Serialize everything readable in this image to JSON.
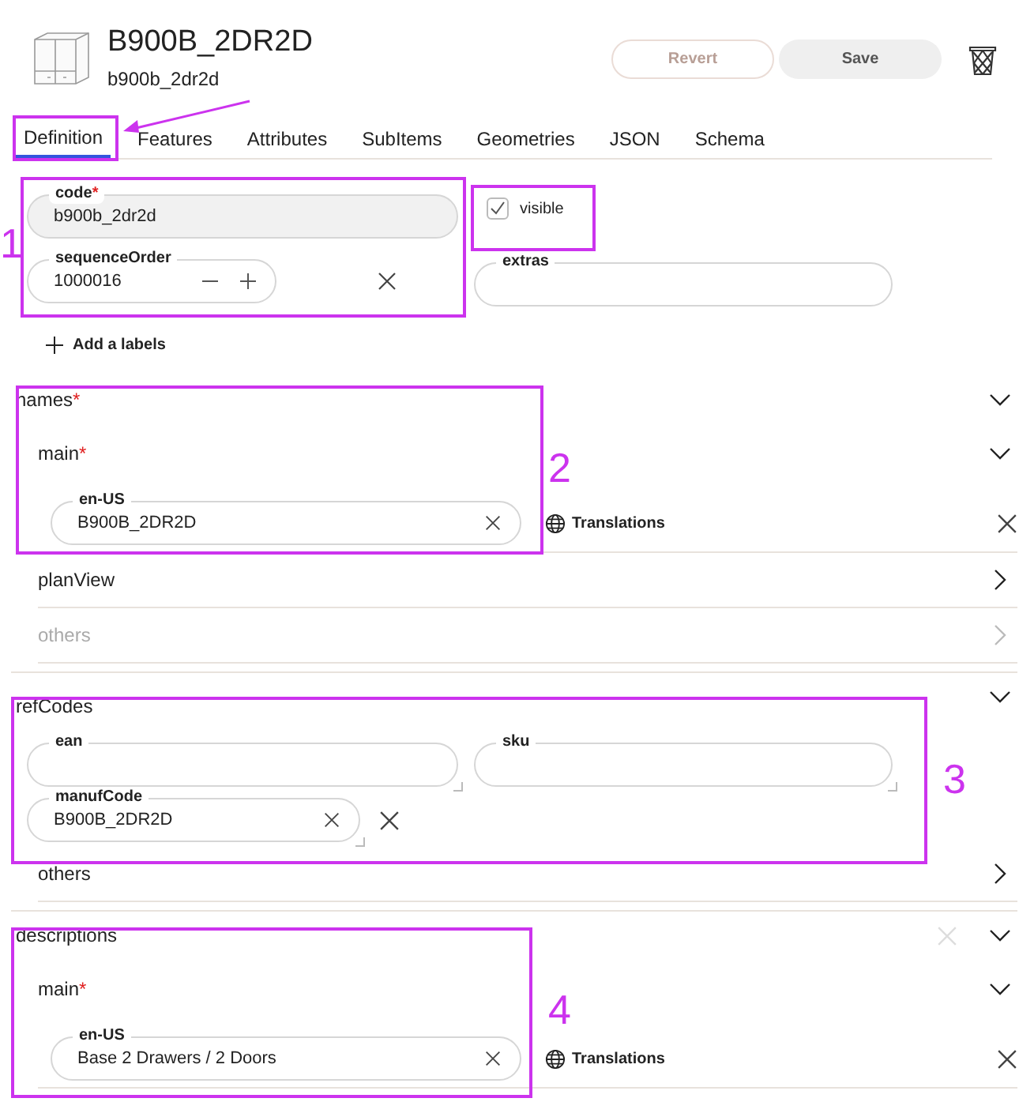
{
  "header": {
    "title": "B900B_2DR2D",
    "subtitle": "b900b_2dr2d",
    "buttons": [
      {
        "label": "Revert",
        "disabled": true
      },
      {
        "label": "Save",
        "disabled": false
      }
    ]
  },
  "tabs": [
    {
      "label": "Definition",
      "selected": true
    },
    {
      "label": "Features",
      "selected": false
    },
    {
      "label": "Attributes",
      "selected": false
    },
    {
      "label": "SubItems",
      "selected": false
    },
    {
      "label": "Geometries",
      "selected": false
    },
    {
      "label": "JSON",
      "selected": false
    },
    {
      "label": "Schema",
      "selected": false
    }
  ],
  "definition": {
    "code": {
      "label": "code",
      "marker": "*",
      "value": "b900b_2dr2d"
    },
    "sequence_order": {
      "label": "sequenceOrder",
      "value": "1000016"
    },
    "visible": {
      "label": "visible",
      "checked": true
    },
    "extras": {
      "label": "extras"
    },
    "add_label": "Add a labels"
  },
  "sections": [
    {
      "title": "names",
      "marker": "*",
      "expanded": true,
      "children": [
        {
          "kind": "locale",
          "title": "main",
          "marker": "*",
          "expanded": true,
          "field": {
            "label": "en-US",
            "value": "B900B_2DR2D"
          },
          "translations": "Translations"
        },
        {
          "kind": "link",
          "title": "planView",
          "disabled": false
        },
        {
          "kind": "link",
          "title": "others",
          "disabled": true
        }
      ]
    },
    {
      "title": "refCodes",
      "expanded": true,
      "children": [
        {
          "kind": "fields",
          "fields": [
            {
              "label": "ean"
            },
            {
              "label": "sku"
            },
            {
              "label": "manufCode",
              "value": "B900B_2DR2D",
              "removable": true
            }
          ]
        },
        {
          "kind": "link",
          "title": "others",
          "disabled": false
        }
      ]
    },
    {
      "title": "descriptions",
      "expanded": true,
      "clear": {
        "disabled": true
      },
      "children": [
        {
          "kind": "locale",
          "title": "main",
          "marker": "*",
          "expanded": true,
          "field": {
            "label": "en-US",
            "value": "Base 2 Drawers  / 2 Doors"
          },
          "translations": "Translations"
        }
      ]
    }
  ],
  "annotations": [
    {
      "label": "1"
    },
    {
      "label": "2"
    },
    {
      "label": "3"
    },
    {
      "label": "4"
    }
  ]
}
